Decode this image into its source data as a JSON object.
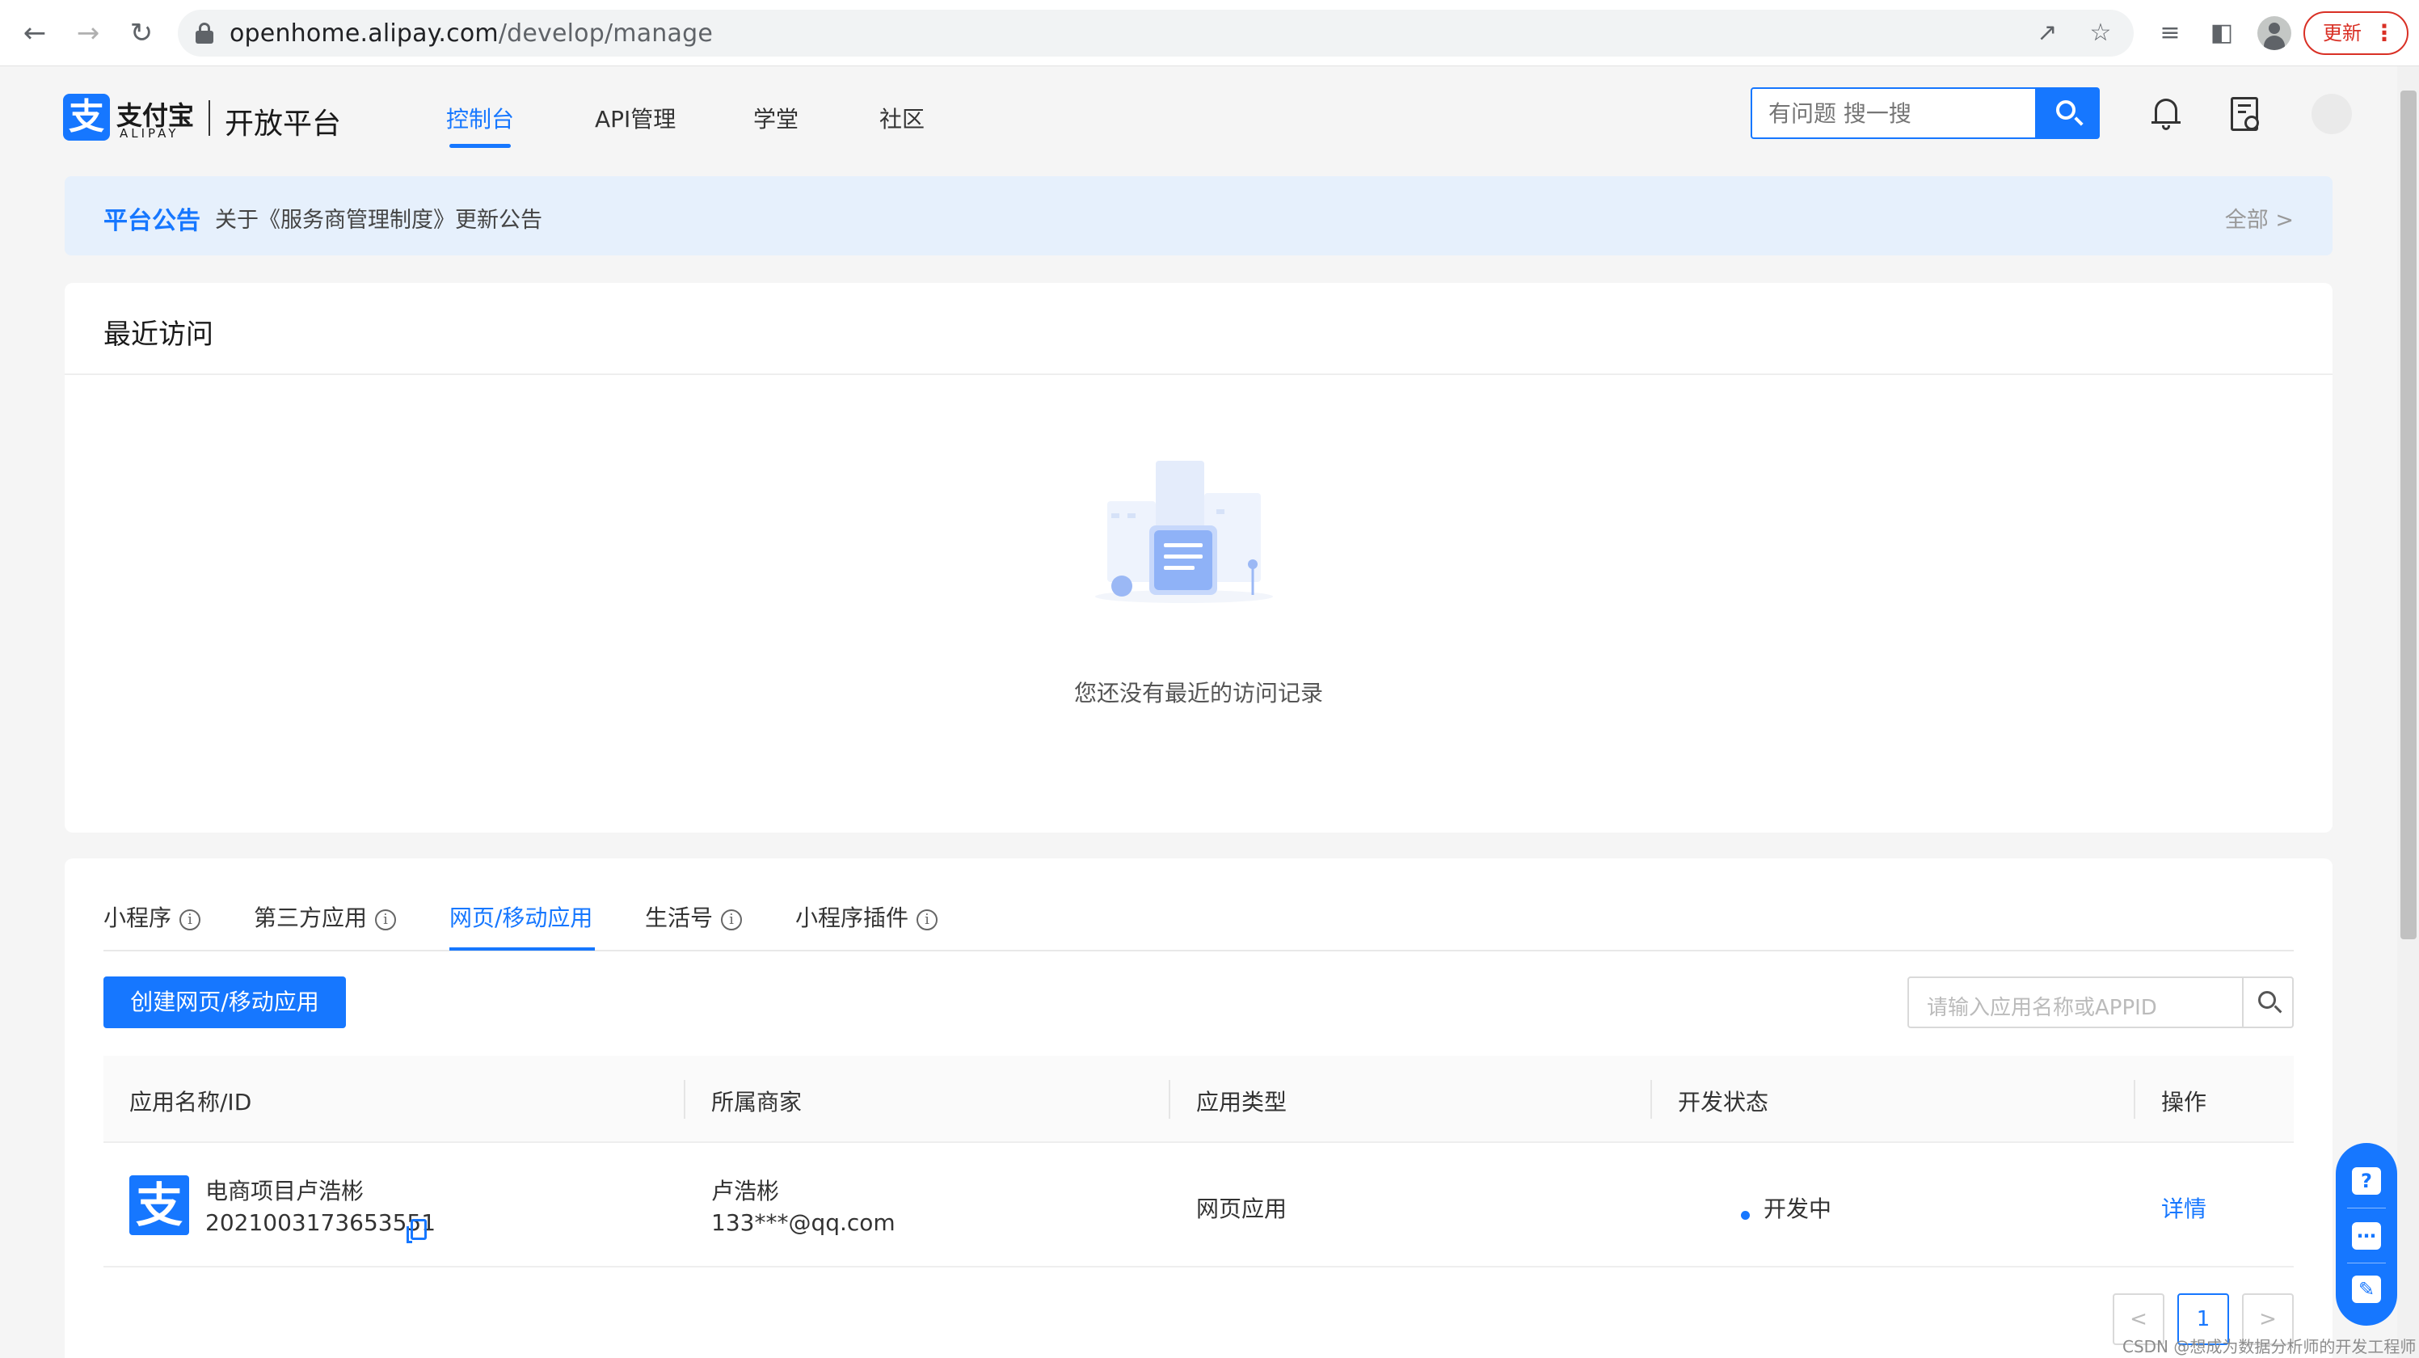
{
  "browser": {
    "url_host": "openhome.alipay.com",
    "url_path": "/develop/manage",
    "update_label": "更新"
  },
  "header": {
    "logo_cn": "支付宝",
    "logo_en": "ALIPAY",
    "logo_mark": "支",
    "platform": "开放平台",
    "nav": [
      "控制台",
      "API管理",
      "学堂",
      "社区"
    ],
    "active_nav": "控制台",
    "search_placeholder": "有问题 搜一搜"
  },
  "announcement": {
    "title": "平台公告",
    "text": "关于《服务商管理制度》更新公告",
    "all": "全部 >"
  },
  "recent": {
    "title": "最近访问",
    "empty_text": "您还没有最近的访问记录"
  },
  "apps": {
    "tabs": [
      "小程序",
      "第三方应用",
      "网页/移动应用",
      "生活号",
      "小程序插件"
    ],
    "active_tab": "网页/移动应用",
    "create_label": "创建网页/移动应用",
    "search_placeholder": "请输入应用名称或APPID",
    "columns": [
      "应用名称/ID",
      "所属商家",
      "应用类型",
      "开发状态",
      "操作"
    ],
    "rows": [
      {
        "name": "电商项目卢浩彬",
        "id": "2021003173653551",
        "merchant": "卢浩彬",
        "merchant_email": "133***@qq.com",
        "type": "网页应用",
        "status": "开发中",
        "action": "详情"
      }
    ],
    "pagination": {
      "prev": "<",
      "current": "1",
      "next": ">"
    }
  },
  "watermark": "CSDN @想成为数据分析师的开发工程师",
  "colors": {
    "accent": "#1677ff",
    "announce_bg": "#e6f0fc",
    "update_red": "#d93025"
  }
}
